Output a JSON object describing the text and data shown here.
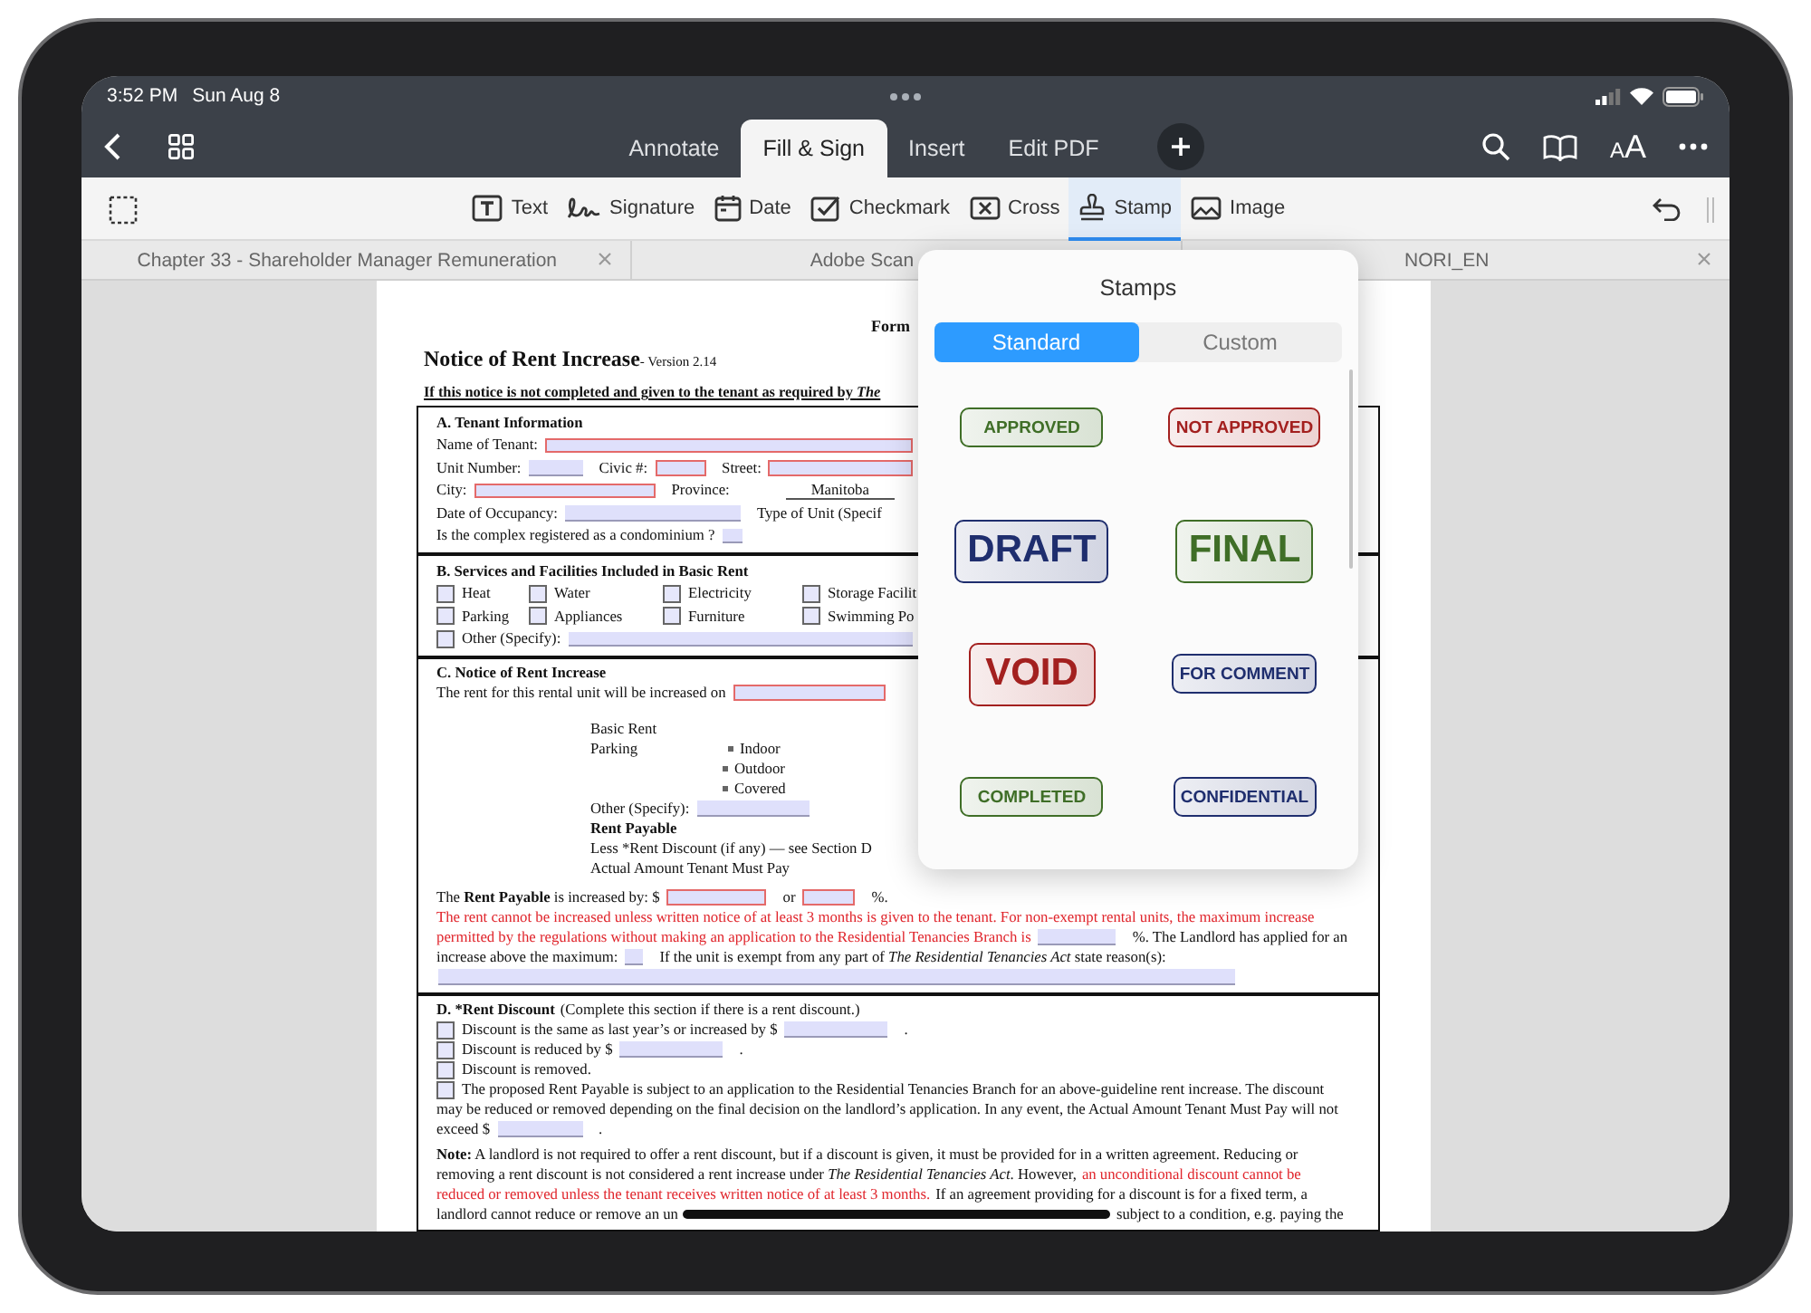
{
  "status_bar": {
    "time": "3:52 PM",
    "date": "Sun Aug 8"
  },
  "nav": {
    "tabs": [
      {
        "label": "Annotate",
        "selected": false
      },
      {
        "label": "Fill & Sign",
        "selected": true
      },
      {
        "label": "Insert",
        "selected": false
      },
      {
        "label": "Edit PDF",
        "selected": false
      }
    ],
    "text_size": {
      "small": "A",
      "large": "A"
    }
  },
  "tools": [
    {
      "kind": "text",
      "label": "Text",
      "selected": false
    },
    {
      "kind": "signature",
      "label": "Signature",
      "selected": false
    },
    {
      "kind": "date",
      "label": "Date",
      "selected": false
    },
    {
      "kind": "checkmark",
      "label": "Checkmark",
      "selected": false
    },
    {
      "kind": "cross",
      "label": "Cross",
      "selected": false
    },
    {
      "kind": "stamp",
      "label": "Stamp",
      "selected": true
    },
    {
      "kind": "image",
      "label": "Image",
      "selected": false
    }
  ],
  "documents": [
    {
      "title": "Chapter 33 - Shareholder Manager Remuneration",
      "close_button": true
    },
    {
      "title": "Adobe Scan"
    },
    {
      "title": "NORI_EN",
      "close_button": true
    }
  ],
  "page": {
    "form_label": "Form",
    "title": "Notice of Rent Increase",
    "version": " - Version 2.14",
    "warning": "If this notice is not completed and given to the tenant as required by *The*",
    "sections": [
      {
        "lines": [
          {
            "kind": "row",
            "segments": [
              {
                "kind": "text",
                "text": "A.  Tenant Information",
                "bold": true
              }
            ]
          },
          {
            "kind": "row",
            "segments": [
              {
                "kind": "text",
                "text": "Name of Tenant:"
              },
              {
                "kind": "field",
                "required": true
              }
            ]
          },
          {
            "kind": "row",
            "segments": [
              {
                "kind": "text",
                "text": "Unit Number:"
              },
              {
                "kind": "field",
                "required": false
              },
              {
                "kind": "text",
                "text": "Civic #:"
              },
              {
                "kind": "field",
                "required": true
              },
              {
                "kind": "text",
                "text": "Street:"
              },
              {
                "kind": "field",
                "required": true
              }
            ]
          },
          {
            "kind": "row",
            "segments": [
              {
                "kind": "text",
                "text": "City:"
              },
              {
                "kind": "field",
                "required": true
              },
              {
                "kind": "text",
                "text": "Province:"
              },
              {
                "kind": "value",
                "text": "Manitoba"
              }
            ]
          },
          {
            "kind": "row",
            "segments": [
              {
                "kind": "text",
                "text": "Date of Occupancy:"
              },
              {
                "kind": "field",
                "required": false
              },
              {
                "kind": "text",
                "text": "Type of Unit (Specif"
              }
            ]
          },
          {
            "kind": "row",
            "segments": [
              {
                "kind": "text",
                "text": "Is the complex registered as a condominium ?"
              },
              {
                "kind": "field",
                "required": false
              }
            ]
          }
        ]
      },
      {
        "lines": [
          {
            "kind": "row",
            "segments": [
              {
                "kind": "text",
                "text": "B.  Services and Facilities Included in Basic Rent",
                "bold": true
              }
            ]
          },
          {
            "kind": "options",
            "items": [
              {
                "label": "Heat",
                "checked": false
              },
              {
                "label": "Water",
                "checked": false
              },
              {
                "label": "Electricity",
                "checked": false
              },
              {
                "label": "Storage Facilit",
                "checked": false
              }
            ]
          },
          {
            "kind": "options",
            "items": [
              {
                "label": "Parking",
                "checked": false
              },
              {
                "label": "Appliances",
                "checked": false
              },
              {
                "label": "Furniture",
                "checked": false
              },
              {
                "label": "Swimming Po",
                "checked": false
              }
            ]
          },
          {
            "kind": "row",
            "segments": [
              {
                "kind": "checkbox",
                "checked": false
              },
              {
                "kind": "text",
                "text": "Other (Specify):"
              },
              {
                "kind": "field",
                "required": false
              }
            ]
          }
        ]
      },
      {
        "lines": [
          {
            "kind": "row",
            "segments": [
              {
                "kind": "text",
                "text": "C.  Notice of Rent Increase",
                "bold": true
              }
            ]
          },
          {
            "kind": "row",
            "segments": [
              {
                "kind": "text",
                "text": "The rent for this rental unit will be increased on"
              },
              {
                "kind": "field",
                "required": true
              }
            ]
          },
          {
            "kind": "sub",
            "segments": [
              {
                "kind": "text",
                "text": "Basic Rent"
              }
            ]
          },
          {
            "kind": "sub",
            "segments": [
              {
                "kind": "text",
                "text": "Parking"
              },
              {
                "kind": "bullet",
                "text": "Indoor"
              }
            ]
          },
          {
            "kind": "bullet",
            "segments": [
              {
                "kind": "bullet",
                "text": "Outdoor"
              }
            ]
          },
          {
            "kind": "bullet",
            "segments": [
              {
                "kind": "bullet",
                "text": "Covered"
              }
            ]
          },
          {
            "kind": "sub",
            "segments": [
              {
                "kind": "text",
                "text": "Other (Specify):"
              },
              {
                "kind": "field",
                "required": false
              }
            ]
          },
          {
            "kind": "sub",
            "segments": [
              {
                "kind": "text",
                "text": "Rent Payable",
                "bold": true
              }
            ]
          },
          {
            "kind": "sub",
            "segments": [
              {
                "kind": "text",
                "text": "Less *Rent Discount (if any) — see Section D"
              }
            ]
          },
          {
            "kind": "sub",
            "segments": [
              {
                "kind": "text",
                "text": "Actual Amount Tenant Must Pay"
              }
            ]
          },
          {
            "kind": "row",
            "segments": [
              {
                "kind": "text",
                "text": "The **Rent Payable** is increased by:  $",
                "markup": true
              },
              {
                "kind": "field",
                "required": true
              },
              {
                "kind": "text",
                "text": "or"
              },
              {
                "kind": "field",
                "required": true
              },
              {
                "kind": "text",
                "text": "%."
              }
            ]
          },
          {
            "kind": "row",
            "segments": [
              {
                "kind": "text",
                "text": "The rent cannot be increased unless written notice of at least 3 months is given to the tenant. For non-exempt rental units, the maximum increase",
                "emphasis": true
              }
            ]
          },
          {
            "kind": "row",
            "segments": [
              {
                "kind": "text",
                "text": "permitted by the regulations without making an application to the Residential Tenancies Branch is",
                "emphasis": true
              },
              {
                "kind": "field",
                "required": false
              },
              {
                "kind": "text",
                "text": "%. The Landlord has applied for an"
              }
            ]
          },
          {
            "kind": "row",
            "segments": [
              {
                "kind": "text",
                "text": "increase above the maximum:"
              },
              {
                "kind": "field",
                "required": false
              },
              {
                "kind": "text",
                "text": "If the unit is exempt from any part of *The Residential Tenancies Act* state reason(s):",
                "markup": true
              }
            ]
          },
          {
            "kind": "row",
            "segments": [
              {
                "kind": "field",
                "required": false
              }
            ]
          }
        ]
      },
      {
        "lines": [
          {
            "kind": "row",
            "segments": [
              {
                "kind": "text",
                "text": "D.  *Rent Discount",
                "bold": true
              },
              {
                "kind": "text",
                "text": "(Complete this section if there is a rent discount.)"
              }
            ]
          },
          {
            "kind": "row",
            "segments": [
              {
                "kind": "checkbox",
                "checked": false
              },
              {
                "kind": "text",
                "text": "Discount is the same as last year’s or increased by $"
              },
              {
                "kind": "field",
                "required": false
              },
              {
                "kind": "text",
                "text": "."
              }
            ]
          },
          {
            "kind": "row",
            "segments": [
              {
                "kind": "checkbox",
                "checked": false
              },
              {
                "kind": "text",
                "text": "Discount is reduced by $"
              },
              {
                "kind": "field",
                "required": false
              },
              {
                "kind": "text",
                "text": "."
              }
            ]
          },
          {
            "kind": "row",
            "segments": [
              {
                "kind": "checkbox",
                "checked": false
              },
              {
                "kind": "text",
                "text": "Discount is removed."
              }
            ]
          },
          {
            "kind": "row",
            "segments": [
              {
                "kind": "checkbox",
                "checked": false
              },
              {
                "kind": "text",
                "text": "The proposed Rent Payable is subject to an application to the Residential Tenancies Branch for an above-guideline rent increase. The discount"
              }
            ]
          },
          {
            "kind": "row",
            "segments": [
              {
                "kind": "text",
                "text": "may be reduced or removed depending on the final decision on the landlord’s application. In any event, the Actual Amount Tenant Must Pay will not"
              }
            ]
          },
          {
            "kind": "row",
            "segments": [
              {
                "kind": "text",
                "text": "exceed $"
              },
              {
                "kind": "field",
                "required": false
              },
              {
                "kind": "text",
                "text": "."
              }
            ]
          },
          {
            "kind": "note",
            "segments": [
              {
                "kind": "text",
                "text": "**Note:** A landlord is not required to offer a rent discount, but if a discount is given, it must be provided for in a written agreement. Reducing or",
                "markup": true
              }
            ]
          },
          {
            "kind": "row",
            "segments": [
              {
                "kind": "text",
                "text": "removing a rent discount is not considered a rent increase under *The Residential Tenancies Act*. However,",
                "markup": true
              },
              {
                "kind": "text",
                "text": "an unconditional discount cannot be",
                "emphasis": true
              }
            ]
          },
          {
            "kind": "row",
            "segments": [
              {
                "kind": "text",
                "text": "reduced or removed unless the tenant receives written notice of at least 3 months.",
                "emphasis": true
              },
              {
                "kind": "text",
                "text": "If an agreement providing for a discount is for a fixed term, a"
              }
            ]
          },
          {
            "kind": "row",
            "segments": [
              {
                "kind": "text",
                "text": "landlord cannot reduce or remove an un"
              },
              {
                "kind": "redaction"
              },
              {
                "kind": "text",
                "text": "subject to a condition, e.g. paying the"
              }
            ]
          }
        ]
      }
    ]
  },
  "stamp_panel": {
    "title": "Stamps",
    "tabs": [
      {
        "label": "Standard",
        "selected": true
      },
      {
        "label": "Custom",
        "selected": false
      }
    ],
    "stamps": [
      {
        "label": "APPROVED",
        "kind": "small",
        "color": "#3f6e27"
      },
      {
        "label": "NOT APPROVED",
        "kind": "small",
        "color": "#a3201f"
      },
      {
        "label": "DRAFT",
        "kind": "large",
        "color": "#1f2e6e"
      },
      {
        "label": "FINAL",
        "kind": "large",
        "color": "#3f6e27"
      },
      {
        "label": "VOID",
        "kind": "large",
        "color": "#a3201f"
      },
      {
        "label": "FOR COMMENT",
        "kind": "small",
        "color": "#1f2e6e"
      },
      {
        "label": "COMPLETED",
        "kind": "small",
        "color": "#3f6e27"
      },
      {
        "label": "CONFIDENTIAL",
        "kind": "small",
        "color": "#1f2e6e"
      }
    ]
  }
}
